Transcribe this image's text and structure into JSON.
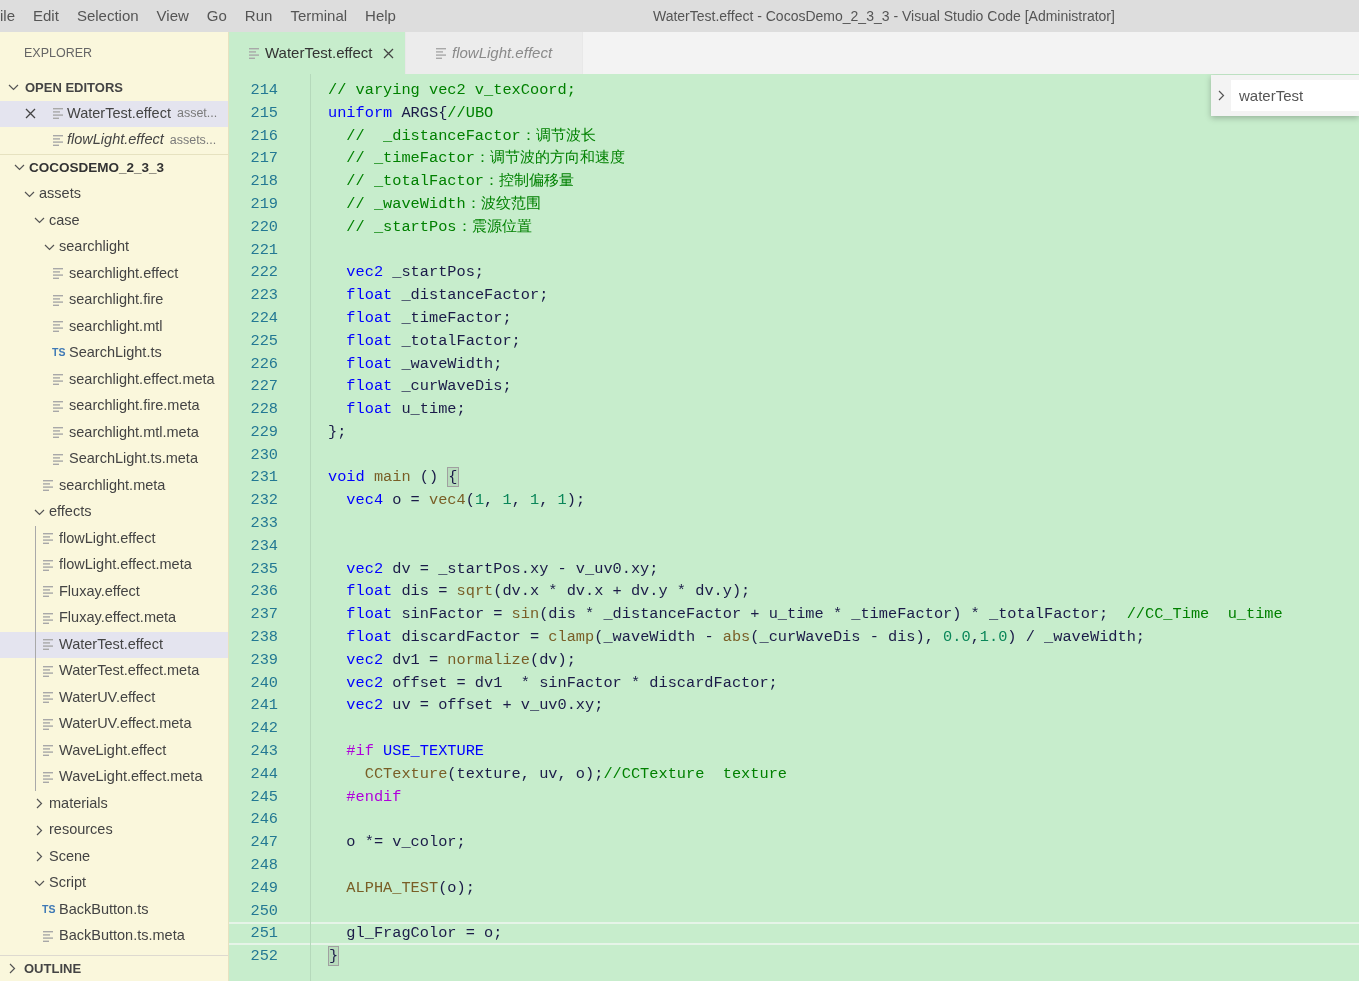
{
  "menu": [
    "ile",
    "Edit",
    "Selection",
    "View",
    "Go",
    "Run",
    "Terminal",
    "Help"
  ],
  "window": {
    "title": "WaterTest.effect - CocosDemo_2_3_3 - Visual Studio Code [Administrator]"
  },
  "sidebar": {
    "title": "EXPLORER",
    "open_editors": {
      "label": "OPEN EDITORS",
      "expanded": true,
      "items": [
        {
          "name": "WaterTest.effect",
          "description": "asset...",
          "selected": true,
          "preview": false,
          "show_close": true
        },
        {
          "name": "flowLight.effect",
          "description": "assets...",
          "selected": false,
          "preview": true,
          "show_close": false
        }
      ]
    },
    "project": {
      "name": "COCOSDEMO_2_3_3",
      "kind": "folder",
      "expanded": true,
      "selected": false,
      "children": [
        {
          "name": "assets",
          "kind": "folder",
          "expanded": true,
          "selected": false,
          "children": [
            {
              "name": "case",
              "kind": "folder",
              "expanded": true,
              "selected": false,
              "children": [
                {
                  "name": "searchlight",
                  "kind": "folder",
                  "expanded": true,
                  "selected": false,
                  "children": [
                    {
                      "name": "searchlight.effect",
                      "kind": "file",
                      "selected": false
                    },
                    {
                      "name": "searchlight.fire",
                      "kind": "file",
                      "selected": false
                    },
                    {
                      "name": "searchlight.mtl",
                      "kind": "file",
                      "selected": false
                    },
                    {
                      "name": "SearchLight.ts",
                      "kind": "file",
                      "icon_label": "TS",
                      "selected": false
                    },
                    {
                      "name": "searchlight.effect.meta",
                      "kind": "file",
                      "selected": false
                    },
                    {
                      "name": "searchlight.fire.meta",
                      "kind": "file",
                      "selected": false
                    },
                    {
                      "name": "searchlight.mtl.meta",
                      "kind": "file",
                      "selected": false
                    },
                    {
                      "name": "SearchLight.ts.meta",
                      "kind": "file",
                      "selected": false
                    }
                  ]
                },
                {
                  "name": "searchlight.meta",
                  "kind": "file",
                  "selected": false
                }
              ]
            },
            {
              "name": "effects",
              "kind": "folder",
              "expanded": true,
              "selected": false,
              "children": [
                {
                  "name": "flowLight.effect",
                  "kind": "file",
                  "selected": false
                },
                {
                  "name": "flowLight.effect.meta",
                  "kind": "file",
                  "selected": false
                },
                {
                  "name": "Fluxay.effect",
                  "kind": "file",
                  "selected": false
                },
                {
                  "name": "Fluxay.effect.meta",
                  "kind": "file",
                  "selected": false
                },
                {
                  "name": "WaterTest.effect",
                  "kind": "file",
                  "selected": true
                },
                {
                  "name": "WaterTest.effect.meta",
                  "kind": "file",
                  "selected": false
                },
                {
                  "name": "WaterUV.effect",
                  "kind": "file",
                  "selected": false
                },
                {
                  "name": "WaterUV.effect.meta",
                  "kind": "file",
                  "selected": false
                },
                {
                  "name": "WaveLight.effect",
                  "kind": "file",
                  "selected": false
                },
                {
                  "name": "WaveLight.effect.meta",
                  "kind": "file",
                  "selected": false
                }
              ]
            },
            {
              "name": "materials",
              "kind": "folder",
              "expanded": false,
              "selected": false
            },
            {
              "name": "resources",
              "kind": "folder",
              "expanded": false,
              "selected": false
            },
            {
              "name": "Scene",
              "kind": "folder",
              "expanded": false,
              "selected": false
            },
            {
              "name": "Script",
              "kind": "folder",
              "expanded": true,
              "selected": false,
              "children": [
                {
                  "name": "BackButton.ts",
                  "kind": "file",
                  "icon_label": "TS",
                  "selected": false
                },
                {
                  "name": "BackButton.ts.meta",
                  "kind": "file",
                  "selected": false
                }
              ]
            }
          ]
        }
      ]
    },
    "outline": {
      "label": "OUTLINE",
      "expanded": false
    }
  },
  "tabs": [
    {
      "label": "WaterTest.effect",
      "selected": true,
      "preview": false,
      "show_close": true
    },
    {
      "label": "flowLight.effect",
      "selected": false,
      "preview": true,
      "show_close": false
    }
  ],
  "find_widget": {
    "value": "waterTest",
    "expanded": false
  },
  "editor": {
    "lines": [
      {
        "number": "214",
        "current": false,
        "tokens": [
          {
            "kind": "comment",
            "text": "// varying vec2 v_texCoord;"
          }
        ]
      },
      {
        "number": "215",
        "current": false,
        "tokens": [
          {
            "kind": "keyword",
            "text": "uniform"
          },
          {
            "kind": "plain",
            "text": " ARGS{"
          },
          {
            "kind": "comment",
            "text": "//UBO"
          }
        ]
      },
      {
        "number": "216",
        "current": false,
        "tokens": [
          {
            "kind": "comment",
            "text": "  //  _distanceFactor：调节波长"
          }
        ]
      },
      {
        "number": "217",
        "current": false,
        "tokens": [
          {
            "kind": "comment",
            "text": "  // _timeFactor：调节波的方向和速度"
          }
        ]
      },
      {
        "number": "218",
        "current": false,
        "tokens": [
          {
            "kind": "comment",
            "text": "  // _totalFactor：控制偏移量"
          }
        ]
      },
      {
        "number": "219",
        "current": false,
        "tokens": [
          {
            "kind": "comment",
            "text": "  // _waveWidth：波纹范围"
          }
        ]
      },
      {
        "number": "220",
        "current": false,
        "tokens": [
          {
            "kind": "comment",
            "text": "  // _startPos：震源位置"
          }
        ]
      },
      {
        "number": "221",
        "current": false
      },
      {
        "number": "222",
        "current": false,
        "tokens": [
          {
            "kind": "keyword",
            "text": "  vec2"
          },
          {
            "kind": "plain",
            "text": " _startPos;"
          }
        ]
      },
      {
        "number": "223",
        "current": false,
        "tokens": [
          {
            "kind": "keyword",
            "text": "  float"
          },
          {
            "kind": "plain",
            "text": " _distanceFactor;"
          }
        ]
      },
      {
        "number": "224",
        "current": false,
        "tokens": [
          {
            "kind": "keyword",
            "text": "  float"
          },
          {
            "kind": "plain",
            "text": " _timeFactor;"
          }
        ]
      },
      {
        "number": "225",
        "current": false,
        "tokens": [
          {
            "kind": "keyword",
            "text": "  float"
          },
          {
            "kind": "plain",
            "text": " _totalFactor;"
          }
        ]
      },
      {
        "number": "226",
        "current": false,
        "tokens": [
          {
            "kind": "keyword",
            "text": "  float"
          },
          {
            "kind": "plain",
            "text": " _waveWidth;"
          }
        ]
      },
      {
        "number": "227",
        "current": false,
        "tokens": [
          {
            "kind": "keyword",
            "text": "  float"
          },
          {
            "kind": "plain",
            "text": " _curWaveDis;"
          }
        ]
      },
      {
        "number": "228",
        "current": false,
        "tokens": [
          {
            "kind": "keyword",
            "text": "  float"
          },
          {
            "kind": "plain",
            "text": " u_time;"
          }
        ]
      },
      {
        "number": "229",
        "current": false,
        "tokens": [
          {
            "kind": "plain",
            "text": "};"
          }
        ]
      },
      {
        "number": "230",
        "current": false
      },
      {
        "number": "231",
        "current": false,
        "tokens": [
          {
            "kind": "keyword",
            "text": "void "
          },
          {
            "kind": "function",
            "text": "main"
          },
          {
            "kind": "plain",
            "text": " () "
          },
          {
            "kind": "bracket",
            "text": "{"
          }
        ]
      },
      {
        "number": "232",
        "current": false,
        "tokens": [
          {
            "kind": "keyword",
            "text": "  vec4"
          },
          {
            "kind": "plain",
            "text": " o = "
          },
          {
            "kind": "function",
            "text": "vec4"
          },
          {
            "kind": "plain",
            "text": "("
          },
          {
            "kind": "number",
            "text": "1"
          },
          {
            "kind": "plain",
            "text": ", "
          },
          {
            "kind": "number",
            "text": "1"
          },
          {
            "kind": "plain",
            "text": ", "
          },
          {
            "kind": "number",
            "text": "1"
          },
          {
            "kind": "plain",
            "text": ", "
          },
          {
            "kind": "number",
            "text": "1"
          },
          {
            "kind": "plain",
            "text": ");"
          }
        ]
      },
      {
        "number": "233",
        "current": false
      },
      {
        "number": "234",
        "current": false
      },
      {
        "number": "235",
        "current": false,
        "tokens": [
          {
            "kind": "keyword",
            "text": "  vec2"
          },
          {
            "kind": "plain",
            "text": " dv = _startPos.xy - v_uv0.xy;"
          }
        ]
      },
      {
        "number": "236",
        "current": false,
        "tokens": [
          {
            "kind": "keyword",
            "text": "  float"
          },
          {
            "kind": "plain",
            "text": " dis = "
          },
          {
            "kind": "function",
            "text": "sqrt"
          },
          {
            "kind": "plain",
            "text": "(dv.x * dv.x + dv.y * dv.y);"
          }
        ]
      },
      {
        "number": "237",
        "current": false,
        "tokens": [
          {
            "kind": "keyword",
            "text": "  float"
          },
          {
            "kind": "plain",
            "text": " sinFactor = "
          },
          {
            "kind": "function",
            "text": "sin"
          },
          {
            "kind": "plain",
            "text": "(dis * _distanceFactor + u_time * _timeFactor) * _totalFactor;  "
          },
          {
            "kind": "comment",
            "text": "//CC_Time  u_time"
          }
        ]
      },
      {
        "number": "238",
        "current": false,
        "tokens": [
          {
            "kind": "keyword",
            "text": "  float"
          },
          {
            "kind": "plain",
            "text": " discardFactor = "
          },
          {
            "kind": "function",
            "text": "clamp"
          },
          {
            "kind": "plain",
            "text": "(_waveWidth - "
          },
          {
            "kind": "function",
            "text": "abs"
          },
          {
            "kind": "plain",
            "text": "(_curWaveDis - dis), "
          },
          {
            "kind": "number",
            "text": "0.0"
          },
          {
            "kind": "plain",
            "text": ","
          },
          {
            "kind": "number",
            "text": "1.0"
          },
          {
            "kind": "plain",
            "text": ") / _waveWidth;"
          }
        ]
      },
      {
        "number": "239",
        "current": false,
        "tokens": [
          {
            "kind": "keyword",
            "text": "  vec2"
          },
          {
            "kind": "plain",
            "text": " dv1 = "
          },
          {
            "kind": "function",
            "text": "normalize"
          },
          {
            "kind": "plain",
            "text": "(dv);"
          }
        ]
      },
      {
        "number": "240",
        "current": false,
        "tokens": [
          {
            "kind": "keyword",
            "text": "  vec2"
          },
          {
            "kind": "plain",
            "text": " offset = dv1  * sinFactor * discardFactor;"
          }
        ]
      },
      {
        "number": "241",
        "current": false,
        "tokens": [
          {
            "kind": "keyword",
            "text": "  vec2"
          },
          {
            "kind": "plain",
            "text": " uv = offset + v_uv0.xy;"
          }
        ]
      },
      {
        "number": "242",
        "current": false
      },
      {
        "number": "243",
        "current": false,
        "tokens": [
          {
            "kind": "preprocessor",
            "text": "  #if "
          },
          {
            "kind": "keyword",
            "text": "USE_TEXTURE"
          }
        ]
      },
      {
        "number": "244",
        "current": false,
        "tokens": [
          {
            "kind": "function",
            "text": "    CCTexture"
          },
          {
            "kind": "plain",
            "text": "(texture, uv, o);"
          },
          {
            "kind": "comment",
            "text": "//CCTexture  texture"
          }
        ]
      },
      {
        "number": "245",
        "current": false,
        "tokens": [
          {
            "kind": "preprocessor",
            "text": "  #endif"
          }
        ]
      },
      {
        "number": "246",
        "current": false
      },
      {
        "number": "247",
        "current": false,
        "tokens": [
          {
            "kind": "plain",
            "text": "  o *= v_color;"
          }
        ]
      },
      {
        "number": "248",
        "current": false
      },
      {
        "number": "249",
        "current": false,
        "tokens": [
          {
            "kind": "function",
            "text": "  ALPHA_TEST"
          },
          {
            "kind": "plain",
            "text": "(o);"
          }
        ]
      },
      {
        "number": "250",
        "current": false
      },
      {
        "number": "251",
        "current": true,
        "tokens": [
          {
            "kind": "plain",
            "text": "  gl_FragColor = o;"
          }
        ]
      },
      {
        "number": "252",
        "current": false,
        "tokens": [
          {
            "kind": "bracket",
            "text": "}"
          }
        ]
      }
    ]
  }
}
